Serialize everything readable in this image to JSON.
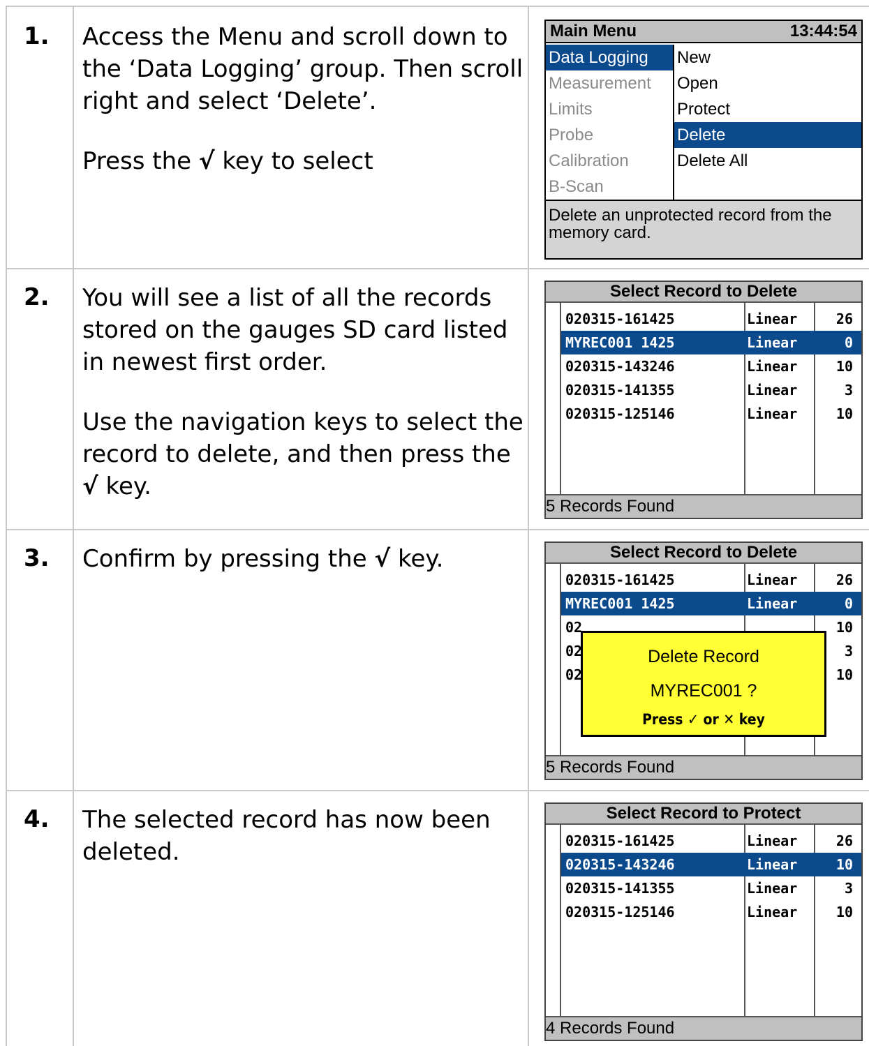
{
  "steps": [
    {
      "number": "1.",
      "text_parts": [
        "Access the Menu and scroll down to the ‘Data Logging’ group. Then scroll right and select ‘Delete’.",
        "Press the ",
        "√",
        " key to select"
      ]
    },
    {
      "number": "2.",
      "text_parts": [
        "You will see a list of all the records stored on the gauges SD card listed in newest first order.",
        "Use the navigation keys to select the record to delete, and then press the ",
        "√",
        " key."
      ]
    },
    {
      "number": "3.",
      "text_parts": [
        "Confirm by pressing the ",
        "√",
        " key."
      ]
    },
    {
      "number": "4.",
      "text_parts": [
        "The selected record has now been deleted."
      ]
    }
  ],
  "screen1": {
    "title": "Main Menu",
    "time": "13:44:54",
    "left_items": [
      "Data Logging",
      "Measurement",
      "Limits",
      "Probe",
      "Calibration",
      "B-Scan"
    ],
    "right_items": [
      "New",
      "Open",
      "Protect",
      "Delete",
      "Delete All"
    ],
    "footer": "Delete an unprotected record from the memory card."
  },
  "screen2": {
    "title": "Select Record to Delete",
    "rows": [
      {
        "name": "020315-161425",
        "type": "Linear",
        "count": "26"
      },
      {
        "name": "MYREC001 1425",
        "type": "Linear",
        "count": "0"
      },
      {
        "name": "020315-143246",
        "type": "Linear",
        "count": "10"
      },
      {
        "name": "020315-141355",
        "type": "Linear",
        "count": "3"
      },
      {
        "name": "020315-125146",
        "type": "Linear",
        "count": "10"
      }
    ],
    "footer": "5 Records Found"
  },
  "screen3": {
    "title": "Select Record to Delete",
    "rows": [
      {
        "name": "020315-161425",
        "type": "Linear",
        "count": "26"
      },
      {
        "name": "MYREC001 1425",
        "type": "Linear",
        "count": "0"
      },
      {
        "name": "02",
        "type": "",
        "count": "10"
      },
      {
        "name": "02",
        "type": "",
        "count": "3"
      },
      {
        "name": "02",
        "type": "",
        "count": "10"
      }
    ],
    "dialog": {
      "line1": "Delete Record",
      "line2": "MYREC001 ?",
      "line3": "Press ✓ or ✕ key"
    },
    "footer": "5 Records Found"
  },
  "screen4": {
    "title": "Select Record to Protect",
    "rows": [
      {
        "name": "020315-161425",
        "type": "Linear",
        "count": "26"
      },
      {
        "name": "020315-143246",
        "type": "Linear",
        "count": "10"
      },
      {
        "name": "020315-141355",
        "type": "Linear",
        "count": "3"
      },
      {
        "name": "020315-125146",
        "type": "Linear",
        "count": "10"
      }
    ],
    "footer": "4 Records Found"
  }
}
